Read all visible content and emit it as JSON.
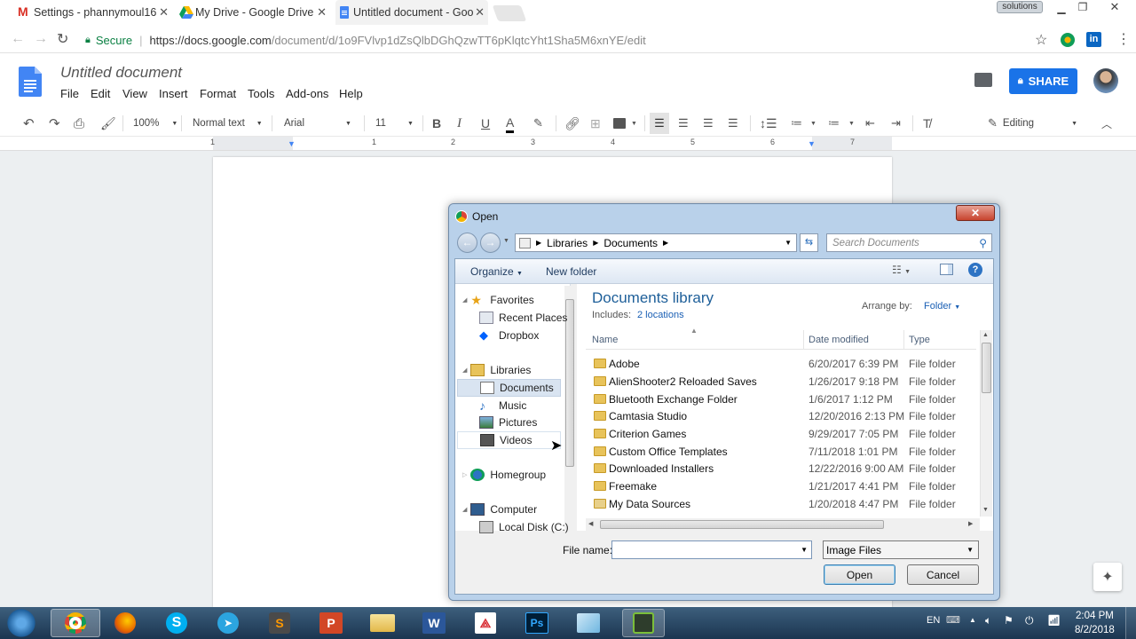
{
  "browser": {
    "tabs": [
      {
        "label": "Settings - phannymoul16"
      },
      {
        "label": "My Drive - Google Drive"
      },
      {
        "label": "Untitled document - Goo"
      }
    ],
    "corner_label": "solutions",
    "secure_label": "Secure",
    "url_host": "https://docs.google.com",
    "url_path": "/document/d/1o9FVlvp1dZsQlbDGhQzwTT6pKlqtcYht1Sha5M6xnYE/edit"
  },
  "docs": {
    "title": "Untitled document",
    "menu": [
      "File",
      "Edit",
      "View",
      "Insert",
      "Format",
      "Tools",
      "Add-ons",
      "Help"
    ],
    "share_label": "SHARE",
    "toolbar": {
      "zoom": "100%",
      "style": "Normal text",
      "font": "Arial",
      "size": "11",
      "mode": "Editing"
    },
    "ruler_numbers": [
      "1",
      "1",
      "2",
      "3",
      "4",
      "5",
      "6",
      "7"
    ]
  },
  "dialog": {
    "title": "Open",
    "breadcrumb": [
      "Libraries",
      "Documents"
    ],
    "search_placeholder": "Search Documents",
    "organize_label": "Organize",
    "new_folder_label": "New folder",
    "nav": {
      "favorites": "Favorites",
      "recent": "Recent Places",
      "dropbox": "Dropbox",
      "libraries": "Libraries",
      "documents": "Documents",
      "music": "Music",
      "pictures": "Pictures",
      "videos": "Videos",
      "homegroup": "Homegroup",
      "computer": "Computer",
      "local_disk": "Local Disk (C:)"
    },
    "library_title": "Documents library",
    "includes_label": "Includes:",
    "includes_link": "2 locations",
    "arrange_label": "Arrange by:",
    "arrange_value": "Folder",
    "columns": {
      "name": "Name",
      "date": "Date modified",
      "type": "Type"
    },
    "files": [
      {
        "name": "Adobe",
        "date": "6/20/2017 6:39 PM",
        "type": "File folder"
      },
      {
        "name": "AlienShooter2 Reloaded Saves",
        "date": "1/26/2017 9:18 PM",
        "type": "File folder"
      },
      {
        "name": "Bluetooth Exchange Folder",
        "date": "1/6/2017 1:12 PM",
        "type": "File folder"
      },
      {
        "name": "Camtasia Studio",
        "date": "12/20/2016 2:13 PM",
        "type": "File folder"
      },
      {
        "name": "Criterion Games",
        "date": "9/29/2017 7:05 PM",
        "type": "File folder"
      },
      {
        "name": "Custom Office Templates",
        "date": "7/11/2018 1:01 PM",
        "type": "File folder"
      },
      {
        "name": "Downloaded Installers",
        "date": "12/22/2016 9:00 AM",
        "type": "File folder"
      },
      {
        "name": "Freemake",
        "date": "1/21/2017 4:41 PM",
        "type": "File folder"
      },
      {
        "name": "My Data Sources",
        "date": "1/20/2018 4:47 PM",
        "type": "File folder"
      }
    ],
    "file_name_label": "File name:",
    "file_name_value": "",
    "file_type": "Image Files",
    "open_label": "Open",
    "cancel_label": "Cancel"
  },
  "taskbar": {
    "lang": "EN",
    "time": "2:04 PM",
    "date": "8/2/2018"
  },
  "colors": {
    "docs_blue": "#4285f4",
    "share_blue": "#1a73e8",
    "library_title": "#1e5f99",
    "link_blue": "#1a5fb4"
  }
}
